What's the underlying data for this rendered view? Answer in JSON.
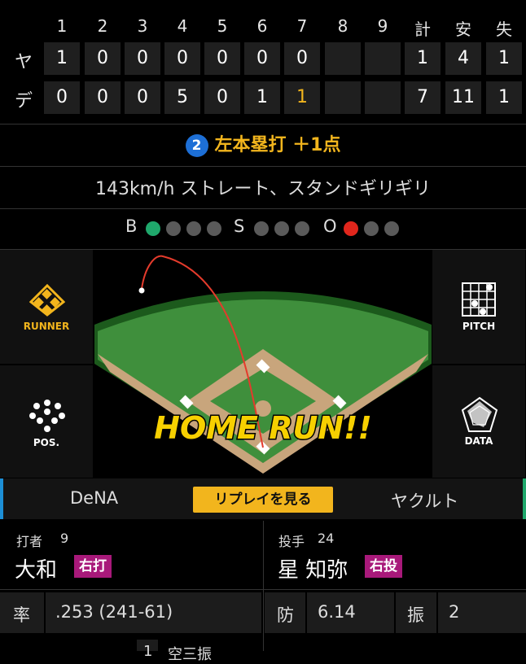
{
  "scoreboard": {
    "innings": [
      "1",
      "2",
      "3",
      "4",
      "5",
      "6",
      "7",
      "8",
      "9"
    ],
    "totals_headers": [
      "計",
      "安",
      "失"
    ],
    "rows": [
      {
        "team": "ヤ",
        "innings": [
          "1",
          "0",
          "0",
          "0",
          "0",
          "0",
          "0",
          "",
          ""
        ],
        "totals": [
          "1",
          "4",
          "1"
        ]
      },
      {
        "team": "デ",
        "innings": [
          "0",
          "0",
          "0",
          "5",
          "0",
          "1",
          "1",
          "",
          ""
        ],
        "totals": [
          "7",
          "11",
          "1"
        ]
      }
    ],
    "highlight_color": "#f2b51d"
  },
  "play": {
    "number": "2",
    "title": "左本塁打 ＋1点",
    "description": "143km/h ストレート、スタンドギリギリ"
  },
  "count": {
    "b_label": "B",
    "s_label": "S",
    "o_label": "O",
    "balls": 1,
    "strikes": 0,
    "outs": 1,
    "ball_color": "#1fa86c",
    "out_color": "#e1261c"
  },
  "side_buttons": {
    "runner": "RUNNER",
    "pos": "POS.",
    "pitch": "PITCH",
    "data": "DATA"
  },
  "field": {
    "banner": "HOME RUN!!"
  },
  "teams_bar": {
    "left": "DeNA",
    "replay": "リプレイを見る",
    "right": "ヤクルト"
  },
  "batter": {
    "role": "打者",
    "number": "9",
    "name": "大和",
    "tag": "右打",
    "stat_label": "率",
    "stat_value": ".253 (241-61)"
  },
  "pitcher": {
    "role": "投手",
    "number": "24",
    "name": "星 知弥",
    "tag": "右投",
    "stat1_label": "防",
    "stat1_value": "6.14",
    "stat2_label": "振",
    "stat2_value": "2"
  },
  "cutoff": {
    "a": "1",
    "b": "空三振"
  }
}
